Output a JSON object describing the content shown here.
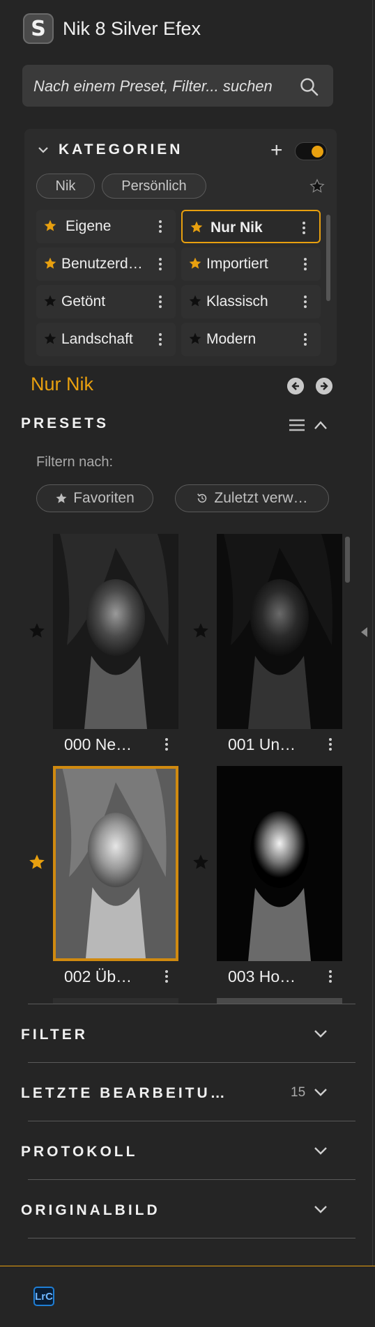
{
  "app": {
    "logo_letter": "S",
    "title": "Nik 8 Silver Efex"
  },
  "search": {
    "placeholder": "Nach einem Preset, Filter... suchen"
  },
  "categories": {
    "title": "KATEGORIEN",
    "toggle_on": true,
    "chips": [
      "Nik",
      "Persönlich"
    ],
    "tiles": [
      {
        "label": "Eigene",
        "starred": true,
        "selected": false
      },
      {
        "label": "Nur Nik",
        "starred": true,
        "selected": true
      },
      {
        "label": "Benutzerd…",
        "starred": true,
        "selected": false
      },
      {
        "label": "Importiert",
        "starred": true,
        "selected": false
      },
      {
        "label": "Getönt",
        "starred": false,
        "selected": false
      },
      {
        "label": "Klassisch",
        "starred": false,
        "selected": false
      },
      {
        "label": "Landschaft",
        "starred": false,
        "selected": false
      },
      {
        "label": "Modern",
        "starred": false,
        "selected": false
      }
    ]
  },
  "current_category": "Nur Nik",
  "presets": {
    "title": "PRESETS",
    "filter_by": "Filtern nach:",
    "filter_favorites": "Favoriten",
    "filter_recent": "Zuletzt verw…",
    "items": [
      {
        "label": "000 Ne…",
        "starred": false,
        "selected": false,
        "tone": "normal"
      },
      {
        "label": "001 Un…",
        "starred": false,
        "selected": false,
        "tone": "dark"
      },
      {
        "label": "002 Üb…",
        "starred": true,
        "selected": true,
        "tone": "bright"
      },
      {
        "label": "003 Ho…",
        "starred": false,
        "selected": false,
        "tone": "contrast"
      }
    ]
  },
  "sections": [
    {
      "title": "FILTER",
      "badge": ""
    },
    {
      "title": "LETZTE BEARBEITU…",
      "badge": "15"
    },
    {
      "title": "PROTOKOLL",
      "badge": ""
    },
    {
      "title": "ORIGINALBILD",
      "badge": ""
    }
  ],
  "footer": {
    "host_badge": "LrC"
  },
  "colors": {
    "accent": "#e8a00f",
    "panel_bg": "#252525",
    "tile_bg": "#303030"
  }
}
